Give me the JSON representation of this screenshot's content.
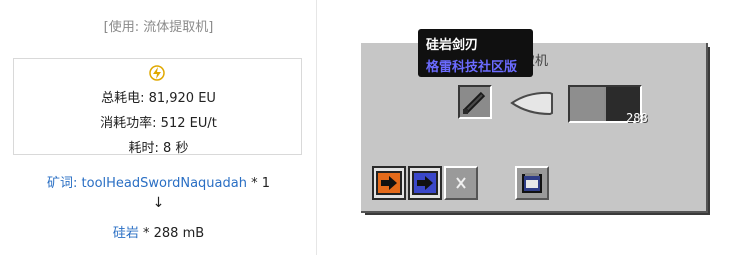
{
  "info": {
    "usage_header": "[使用: 流体提取机]",
    "total_energy": "总耗电: 81,920 EU",
    "power": "消耗功率: 512 EU/t",
    "time": "耗时: 8 秒"
  },
  "recipe": {
    "input_prefix": "矿词:",
    "input_name": "toolHeadSwordNaquadah",
    "input_qty": " * 1",
    "arrow": "↓",
    "output_name": "硅岩",
    "output_qty": " * 288 mB"
  },
  "gui": {
    "title": "流体提取机",
    "fluid_amount": "288"
  },
  "tooltip": {
    "item_name": "硅岩剑刃",
    "mod_name": "格雷科技社区版"
  },
  "colors": {
    "link": "#2a6fc4",
    "gui_background": "#c6c6c6",
    "tooltip_mod": "#6b6bff"
  }
}
